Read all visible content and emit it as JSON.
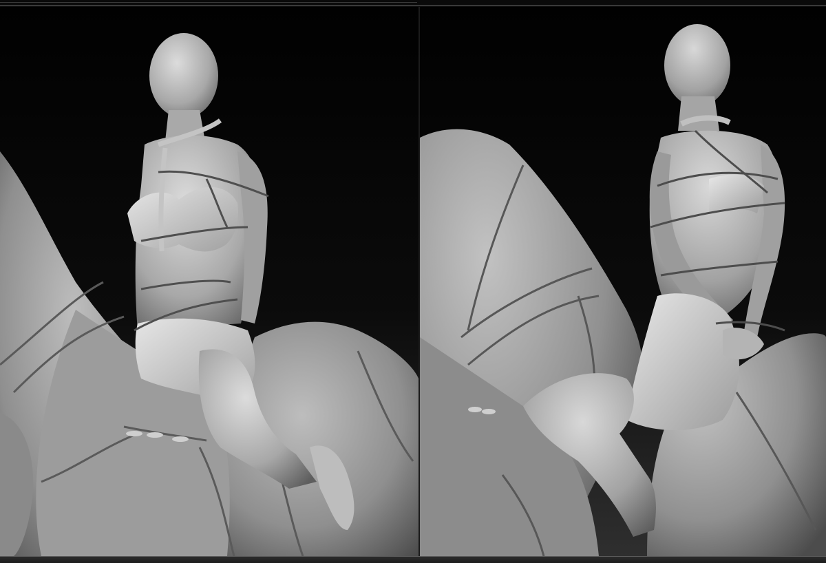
{
  "image": {
    "description_free": true,
    "colors": {
      "background_top": "#020202",
      "background_bottom": "#2b2b2b",
      "clay_light": "#d4d4d4",
      "clay_mid": "#9a9a9a",
      "clay_dark": "#555555",
      "wire": "#4a4a4a",
      "rope": "#b8b8b8"
    }
  }
}
